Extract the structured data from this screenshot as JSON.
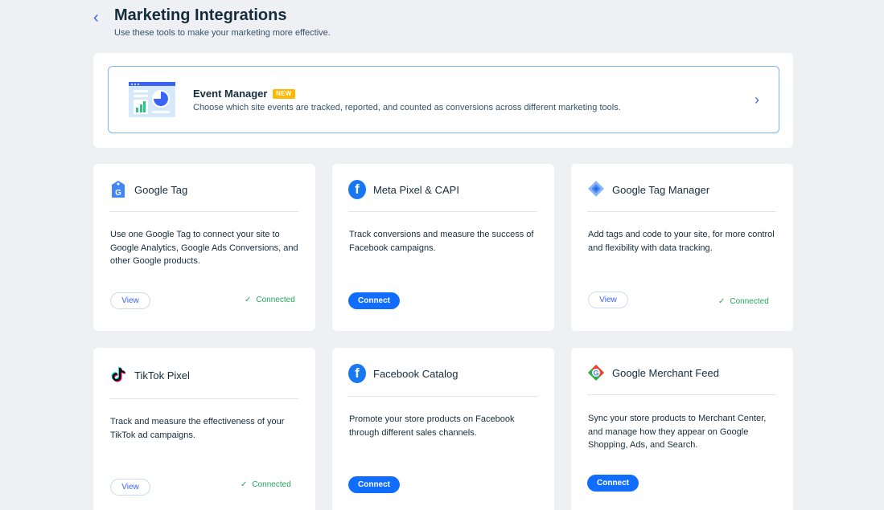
{
  "header": {
    "title": "Marketing Integrations",
    "subtitle": "Use these tools to make your marketing more effective."
  },
  "event_manager": {
    "title": "Event Manager",
    "badge": "NEW",
    "description": "Choose which site events are tracked, reported, and counted as conversions across different marketing tools."
  },
  "cards": [
    {
      "name": "Google Tag",
      "icon": "google-tag-icon",
      "description": "Use one Google Tag to connect your site to Google Analytics, Google Ads Conversions, and other Google products.",
      "button": "View",
      "status": "Connected"
    },
    {
      "name": "Meta Pixel & CAPI",
      "icon": "facebook-icon",
      "description": "Track conversions and measure the success of Facebook campaigns.",
      "button": "Connect"
    },
    {
      "name": "Google Tag Manager",
      "icon": "google-tag-manager-icon",
      "description": "Add tags and code to your site, for more control and flexibility with data tracking.",
      "button": "View",
      "status": "Connected"
    },
    {
      "name": "TikTok Pixel",
      "icon": "tiktok-icon",
      "description": "Track and measure the effectiveness of your TikTok ad campaigns.",
      "button": "View",
      "status": "Connected"
    },
    {
      "name": "Facebook Catalog",
      "icon": "facebook-icon",
      "description": "Promote your store products on Facebook through different sales channels.",
      "button": "Connect"
    },
    {
      "name": "Google Merchant Feed",
      "icon": "google-merchant-icon",
      "description": "Sync your store products to Merchant Center, and manage how they appear on Google Shopping, Ads, and Search.",
      "button": "Connect"
    }
  ],
  "colors": {
    "background": "#eef0f4",
    "accent": "#116dff",
    "connected": "#25a55a",
    "badge": "#ffb700"
  }
}
